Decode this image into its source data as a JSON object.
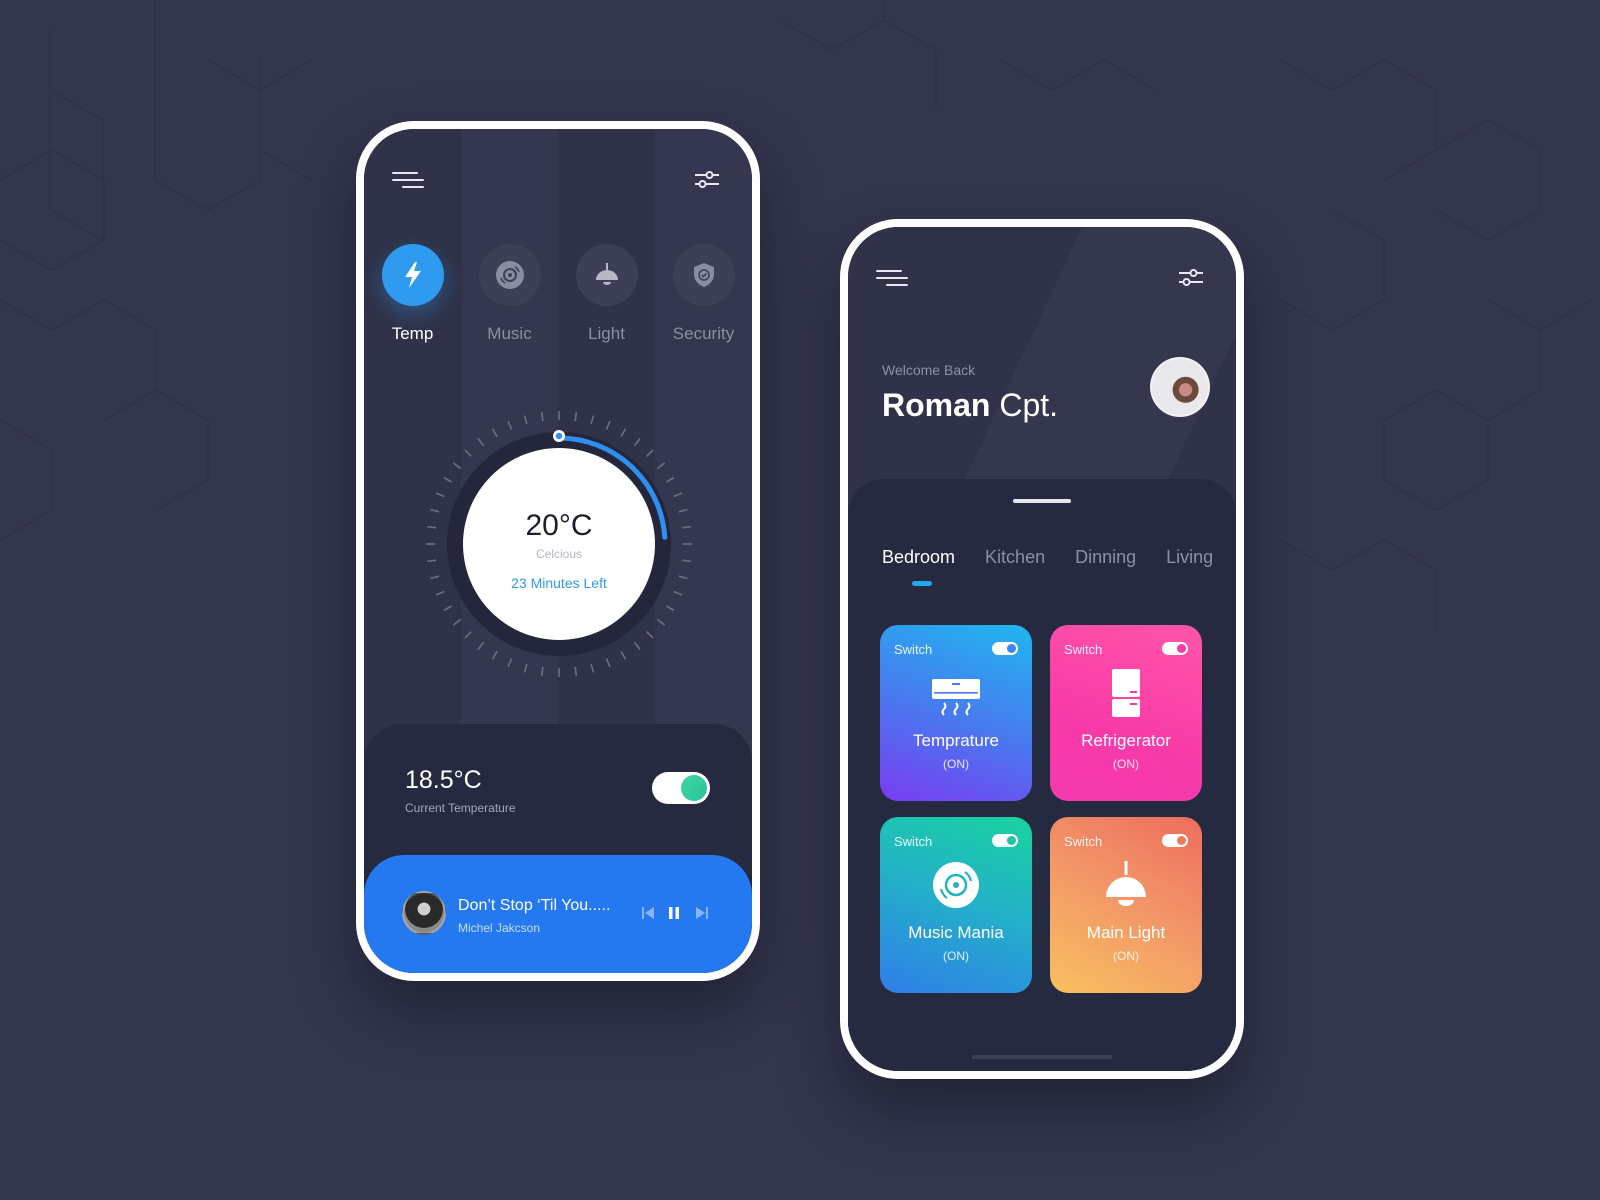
{
  "colors": {
    "background": "#33364d",
    "accent_blue": "#2f9bf0",
    "player_blue": "#2478f0",
    "toggle_green": "#3fd6a5",
    "tab_indicator": "#22a7f0"
  },
  "left_phone": {
    "header": {
      "menu_icon": "hamburger-menu-icon",
      "filter_icon": "sliders-icon"
    },
    "categories": [
      {
        "label": "Temp",
        "icon": "lightning-icon",
        "active": true
      },
      {
        "label": "Music",
        "icon": "vinyl-disc-icon",
        "active": false
      },
      {
        "label": "Light",
        "icon": "pendant-lamp-icon",
        "active": false
      },
      {
        "label": "Security",
        "icon": "shield-icon",
        "active": false
      }
    ],
    "thermostat": {
      "temperature": "20°C",
      "unit_label": "Celcious",
      "timer": "23 Minutes Left",
      "progress_fraction": 0.24
    },
    "current": {
      "temperature": "18.5°C",
      "label": "Current Temperature",
      "toggle_on": true
    },
    "player": {
      "title": "Don’t Stop ‘Til You.....",
      "artist": "Michel Jakcson",
      "controls": [
        "previous-icon",
        "pause-icon",
        "next-icon"
      ]
    }
  },
  "right_phone": {
    "header": {
      "menu_icon": "hamburger-menu-icon",
      "filter_icon": "sliders-icon"
    },
    "greeting": "Welcome Back",
    "user_first": "Roman",
    "user_last": "Cpt.",
    "tabs": [
      {
        "label": "Bedroom",
        "active": true
      },
      {
        "label": "Kitchen",
        "active": false
      },
      {
        "label": "Dinning",
        "active": false
      },
      {
        "label": "Living",
        "active": false
      }
    ],
    "devices": [
      {
        "switch_label": "Switch",
        "name": "Temprature",
        "state": "(ON)",
        "icon": "air-conditioner-icon",
        "toggle_on": true,
        "knob_color": "#3b86f0"
      },
      {
        "switch_label": "Switch",
        "name": "Refrigerator",
        "state": "(ON)",
        "icon": "refrigerator-icon",
        "toggle_on": true,
        "knob_color": "#f83aa8"
      },
      {
        "switch_label": "Switch",
        "name": "Music Mania",
        "state": "(ON)",
        "icon": "vinyl-disc-icon",
        "toggle_on": true,
        "knob_color": "#1fc4a6"
      },
      {
        "switch_label": "Switch",
        "name": "Main Light",
        "state": "(ON)",
        "icon": "pendant-lamp-icon",
        "toggle_on": true,
        "knob_color": "#f07a55"
      }
    ]
  }
}
